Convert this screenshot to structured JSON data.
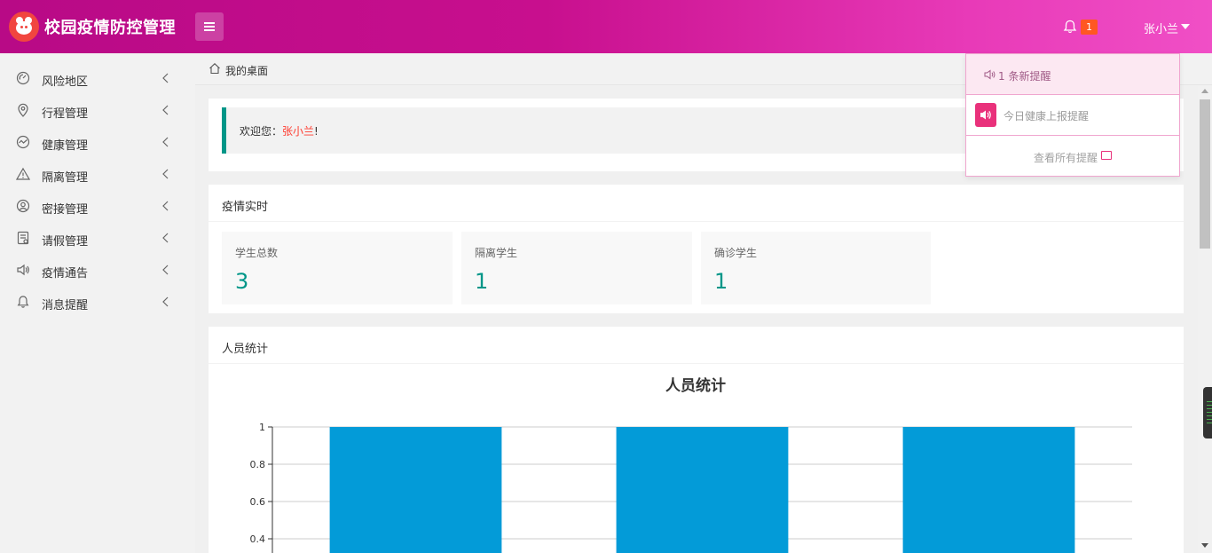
{
  "app": {
    "title": "校园疫情防控管理"
  },
  "header": {
    "notification_count": "1",
    "user_name": "张小兰"
  },
  "sidebar": {
    "items": [
      {
        "label": "风险地区",
        "icon": "dashboard-icon"
      },
      {
        "label": "行程管理",
        "icon": "location-icon"
      },
      {
        "label": "健康管理",
        "icon": "health-chart-icon"
      },
      {
        "label": "隔离管理",
        "icon": "warning-icon"
      },
      {
        "label": "密接管理",
        "icon": "user-icon"
      },
      {
        "label": "请假管理",
        "icon": "form-icon"
      },
      {
        "label": "疫情通告",
        "icon": "speaker-icon"
      },
      {
        "label": "消息提醒",
        "icon": "bell-icon"
      }
    ]
  },
  "breadcrumb": {
    "label": "我的桌面"
  },
  "welcome": {
    "prefix": "欢迎您：",
    "name": "张小兰",
    "suffix": "!"
  },
  "epidemic": {
    "title": "疫情实时",
    "stats": [
      {
        "label": "学生总数",
        "value": "3"
      },
      {
        "label": "隔离学生",
        "value": "1"
      },
      {
        "label": "确诊学生",
        "value": "1"
      }
    ]
  },
  "people": {
    "title": "人员统计"
  },
  "chart_data": {
    "type": "bar",
    "title": "人员统计",
    "categories": [
      "",
      "",
      ""
    ],
    "values": [
      1,
      1,
      1
    ],
    "ylim": [
      0,
      1
    ],
    "yticks": [
      "1",
      "0.8",
      "0.6",
      "0.4"
    ],
    "grid": true,
    "bar_color": "#039bd8"
  },
  "notifications": {
    "header": "1 条新提醒",
    "items": [
      {
        "text": "今日健康上报提醒"
      }
    ],
    "footer": "查看所有提醒"
  },
  "colors": {
    "header_start": "#b80a86",
    "header_end": "#f04fc6",
    "accent": "#009688",
    "highlight": "#ff3b2f",
    "badge": "#ff5722"
  }
}
